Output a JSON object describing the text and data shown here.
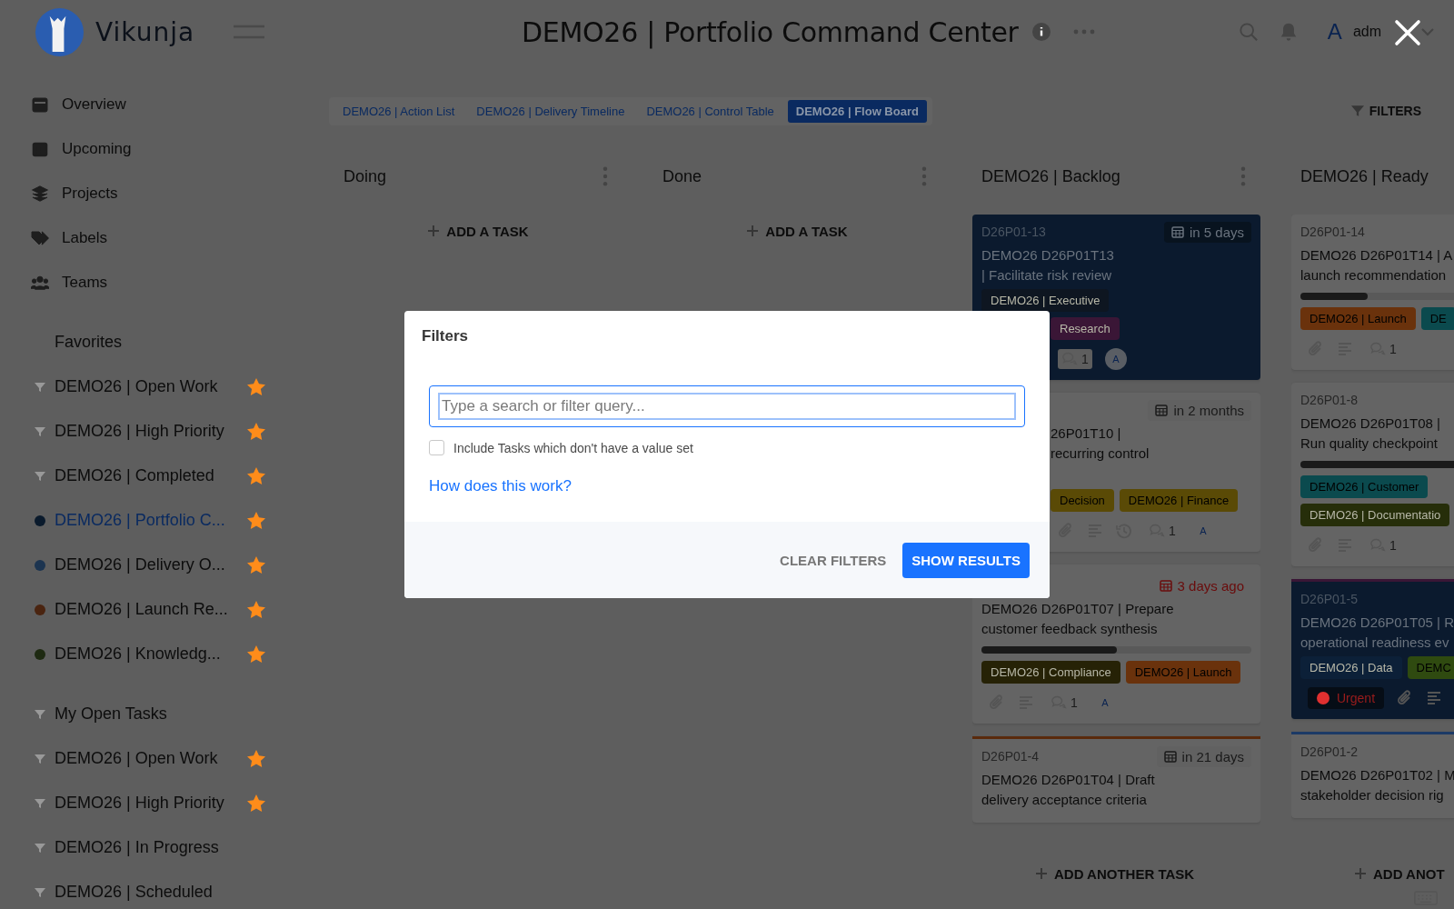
{
  "brand": {
    "name": "Vikunja"
  },
  "header": {
    "title": "DEMO26 | Portfolio Command Center",
    "avatar": "A",
    "user": "adm"
  },
  "nav": [
    {
      "kind": "overview",
      "label": "Overview"
    },
    {
      "kind": "upcoming",
      "label": "Upcoming"
    },
    {
      "kind": "projects",
      "label": "Projects"
    },
    {
      "kind": "labels",
      "label": "Labels"
    },
    {
      "kind": "teams",
      "label": "Teams"
    }
  ],
  "sections": [
    {
      "title": "Favorites",
      "kind": "plain",
      "items": [
        {
          "kind": "filter",
          "label": "DEMO26 | Open Work",
          "favorite": true,
          "selected": false
        },
        {
          "kind": "filter",
          "label": "DEMO26 | High Priority",
          "favorite": true,
          "selected": false
        },
        {
          "kind": "filter",
          "label": "DEMO26 | Completed",
          "favorite": true,
          "selected": false
        },
        {
          "kind": "project",
          "label": "DEMO26 | Portfolio C...",
          "color": "#0a1a2c",
          "favorite": true,
          "selected": true
        },
        {
          "kind": "project",
          "label": "DEMO26 | Delivery O...",
          "color": "#1c3450",
          "favorite": true,
          "selected": false
        },
        {
          "kind": "project",
          "label": "DEMO26 | Launch Re...",
          "color": "#4a2410",
          "favorite": true,
          "selected": false
        },
        {
          "kind": "project",
          "label": "DEMO26 | Knowledg...",
          "color": "#1e2a12",
          "favorite": true,
          "selected": false
        }
      ]
    },
    {
      "title": "My Open Tasks",
      "kind": "filter",
      "items": [
        {
          "kind": "filter",
          "label": "DEMO26 | Open Work",
          "favorite": true,
          "selected": false
        },
        {
          "kind": "filter",
          "label": "DEMO26 | High Priority",
          "favorite": true,
          "selected": false
        },
        {
          "kind": "filter",
          "label": "DEMO26 | In Progress",
          "favorite": false,
          "selected": false
        },
        {
          "kind": "filter",
          "label": "DEMO26 | Scheduled",
          "favorite": false,
          "selected": false
        }
      ]
    }
  ],
  "views": [
    {
      "label": "DEMO26 | Action List",
      "selected": false
    },
    {
      "label": "DEMO26 | Delivery Timeline",
      "selected": false
    },
    {
      "label": "DEMO26 | Control Table",
      "selected": false
    },
    {
      "label": "DEMO26 | Flow Board",
      "selected": true
    }
  ],
  "filters_button": "FILTERS",
  "columns": [
    {
      "title": "Doing",
      "menu": true,
      "add_label": "ADD A TASK"
    },
    {
      "title": "Done",
      "menu": true,
      "add_label": "ADD A TASK"
    },
    {
      "title": "DEMO26 | Backlog",
      "menu": true,
      "add_label": "ADD ANOTHER TASK",
      "cards": [
        {
          "id": "D26P01-13",
          "due": "in 5 days",
          "overdue": false,
          "kind": "dark",
          "title": [
            "DEMO26 D26P01T13",
            "| Facilitate risk review"
          ],
          "labels": [
            {
              "text": "DEMO26 | Executive",
              "color": "#0e1621"
            },
            {
              "text": "Research",
              "color": "#3a1636",
              "covered": true
            }
          ],
          "icons": [
            {
              "kind": "comments",
              "text": "1",
              "covered": true
            },
            {
              "kind": "avatar",
              "text": "A"
            }
          ]
        },
        {
          "due": "in 2 months",
          "overdue": false,
          "kind": "plain",
          "title": [
            "26P01T10 |",
            "recurring control"
          ],
          "title_covered": true,
          "labels": [
            {
              "text": "Decision",
              "color": "#5a4a06",
              "covered": true
            },
            {
              "text": "DEMO26 | Finance",
              "color": "#5a4a06"
            }
          ],
          "icons": [
            {
              "kind": "attachment",
              "covered": true
            },
            {
              "kind": "description"
            },
            {
              "kind": "history"
            },
            {
              "kind": "comments",
              "text": "1"
            },
            {
              "kind": "avatar",
              "text": "A"
            }
          ]
        },
        {
          "due": "3 days ago",
          "overdue": true,
          "kind": "plain",
          "title": [
            "DEMO26 D26P01T07 | Prepare",
            "customer feedback synthesis"
          ],
          "level": 0.5,
          "labels": [
            {
              "text": "DEMO26 | Compliance",
              "color": "#262206"
            },
            {
              "text": "DEMO26 | Launch",
              "color": "#6a320c"
            }
          ],
          "icons": [
            {
              "kind": "attachment"
            },
            {
              "kind": "description"
            },
            {
              "kind": "comments",
              "text": "1"
            },
            {
              "kind": "avatar",
              "text": "A"
            }
          ]
        },
        {
          "id": "D26P01-4",
          "due": "in 21 days",
          "overdue": false,
          "kind": "plain",
          "color": "#5a2a0c",
          "title": [
            "DEMO26 D26P01T04 | Draft",
            "delivery acceptance criteria"
          ]
        }
      ]
    },
    {
      "title": "DEMO26 | Ready",
      "menu": false,
      "add_label": "ADD ANOT",
      "cards": [
        {
          "id": "D26P01-14",
          "kind": "plain",
          "title": [
            "DEMO26 D26P01T14 | A",
            "launch recommendation"
          ],
          "level": 0.25,
          "labels": [
            {
              "text": "DEMO26 | Launch",
              "color": "#6a320c"
            },
            {
              "text": "DE",
              "color": "#0b4a4e"
            }
          ],
          "icons": [
            {
              "kind": "attachment"
            },
            {
              "kind": "description"
            },
            {
              "kind": "comments",
              "text": "1"
            }
          ]
        },
        {
          "id": "D26P01-8",
          "kind": "plain",
          "title": [
            "DEMO26 D26P01T08 |",
            "Run quality checkpoint"
          ],
          "level": 1,
          "labels": [
            {
              "text": "DEMO26 | Customer",
              "color": "#0b4a4e"
            },
            {
              "text": "DEMO26 | Documentatio",
              "color": "#262e0a"
            }
          ],
          "icons": [
            {
              "kind": "attachment"
            },
            {
              "kind": "description"
            },
            {
              "kind": "comments",
              "text": "1"
            }
          ]
        },
        {
          "id": "D26P01-5",
          "kind": "dark",
          "color": "#3a1636",
          "title": [
            "DEMO26 D26P01T05 | R",
            "operational readiness ev"
          ],
          "labels": [
            {
              "text": "DEMO26 | Data",
              "color": "#0c2038"
            },
            {
              "text": "DEMC",
              "color": "#2f4a10"
            }
          ],
          "icons": [
            {
              "kind": "priority",
              "text": "Urgent"
            },
            {
              "kind": "attachment"
            },
            {
              "kind": "description"
            }
          ]
        },
        {
          "id": "D26P01-2",
          "kind": "plain",
          "color": "#1c3a66",
          "title": [
            "DEMO26 D26P01T02 | M",
            "stakeholder decision rig"
          ]
        }
      ]
    }
  ],
  "modal": {
    "title": "Filters",
    "placeholder": "Type a search or filter query...",
    "include_empty": {
      "label": "Include Tasks which don't have a value set",
      "checked": false
    },
    "help_link": "How does this work?",
    "buttons": [
      {
        "kind": "text",
        "label": "CLEAR FILTERS"
      },
      {
        "kind": "primary",
        "label": "SHOW RESULTS"
      }
    ]
  }
}
